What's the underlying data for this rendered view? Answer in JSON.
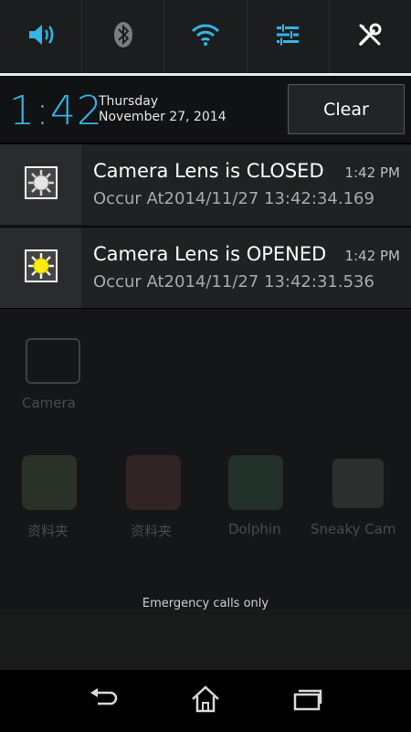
{
  "quick_settings": {
    "items": [
      {
        "icon": "volume-icon"
      },
      {
        "icon": "bluetooth-icon"
      },
      {
        "icon": "wifi-icon"
      },
      {
        "icon": "settings-sliders-icon"
      },
      {
        "icon": "tools-icon"
      }
    ],
    "accent": "#33b5e5"
  },
  "header": {
    "time": "1:42",
    "day": "Thursday",
    "date": "November 27, 2014",
    "clear_label": "Clear"
  },
  "notifications": [
    {
      "icon": "sun-gray-icon",
      "title": "Camera Lens is CLOSED",
      "time": "1:42 PM",
      "subtitle": "Occur At2014/11/27 13:42:34.169"
    },
    {
      "icon": "sun-yellow-icon",
      "title": "Camera Lens is OPENED",
      "time": "1:42 PM",
      "subtitle": "Occur At2014/11/27 13:42:31.536"
    }
  ],
  "home": {
    "apps": [
      "Camera",
      "资料夹",
      "资料夹",
      "Dolphin",
      "Sneaky Cam"
    ]
  },
  "lock_status": "Emergency calls only",
  "nav": {
    "items": [
      {
        "icon": "back-icon"
      },
      {
        "icon": "home-icon"
      },
      {
        "icon": "recents-icon"
      }
    ]
  }
}
